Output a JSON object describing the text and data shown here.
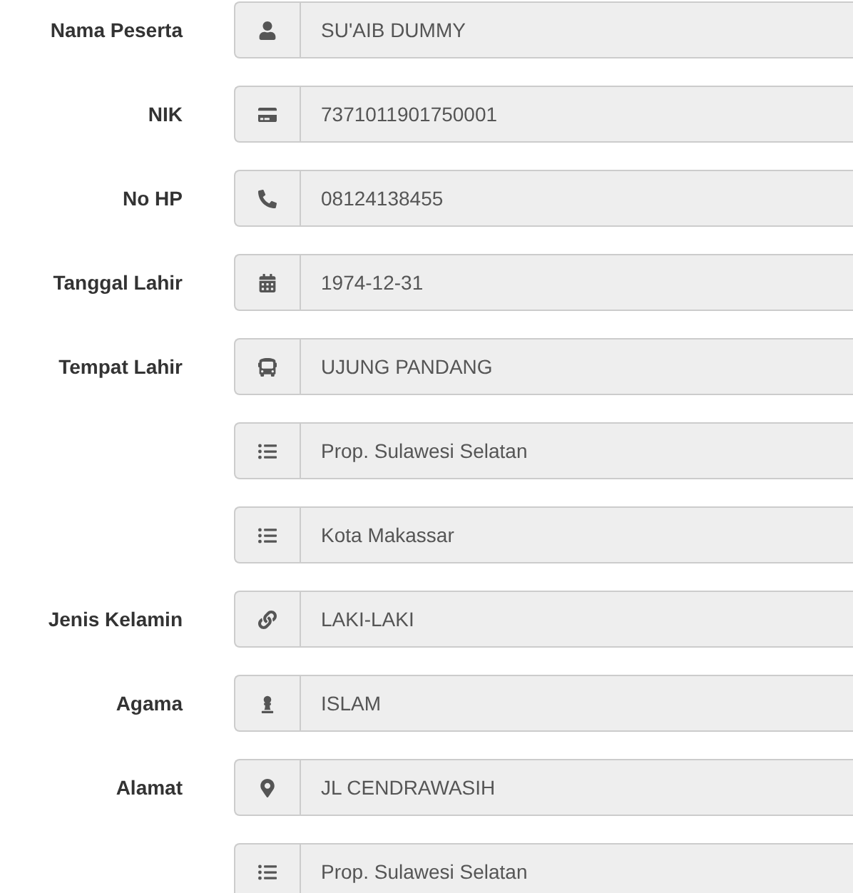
{
  "fields": [
    {
      "kind": "name",
      "label": "Nama Peserta",
      "value": "SU'AIB DUMMY"
    },
    {
      "kind": "id",
      "label": "NIK",
      "value": "7371011901750001"
    },
    {
      "kind": "phone",
      "label": "No HP",
      "value": "08124138455"
    },
    {
      "kind": "date",
      "label": "Tanggal Lahir",
      "value": "1974-12-31"
    },
    {
      "kind": "place",
      "label": "Tempat Lahir",
      "value": "UJUNG PANDANG"
    },
    {
      "kind": "region",
      "value": "Prop. Sulawesi Selatan"
    },
    {
      "kind": "region",
      "value": "Kota Makassar"
    },
    {
      "kind": "gender",
      "label": "Jenis Kelamin",
      "value": "LAKI-LAKI"
    },
    {
      "kind": "religion",
      "label": "Agama",
      "value": "ISLAM"
    },
    {
      "kind": "address",
      "label": "Alamat",
      "value": "JL CENDRAWASIH"
    },
    {
      "kind": "region",
      "value": "Prop. Sulawesi Selatan"
    }
  ]
}
